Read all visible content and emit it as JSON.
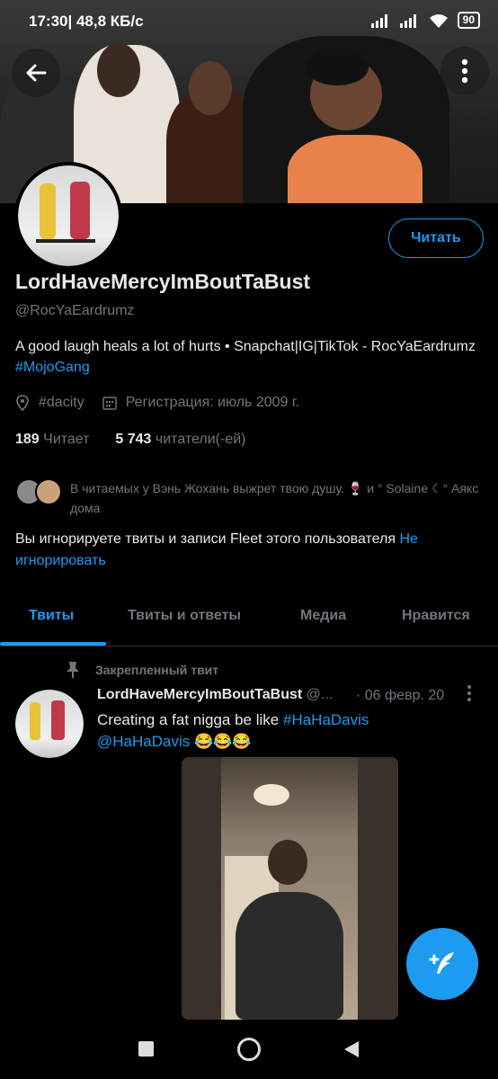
{
  "status_bar": {
    "time": "17:30",
    "speed": "| 48,8 КБ/с",
    "battery": "90"
  },
  "profile": {
    "display_name": "LordHaveMercyImBoutTaBust",
    "handle": "@RocYaEardrumz",
    "bio_text": "A good laugh heals a lot of hurts • Snapchat|IG|TikTok - RocYaEardrumz",
    "bio_hashtag": "#MojoGang",
    "location": "#dacity",
    "joined": "Регистрация: июль 2009 г.",
    "following_count": "189",
    "following_label": "Читает",
    "followers_count": "5 743",
    "followers_label": "читатели(-ей)",
    "known_followers_text": "В читаемых у Вэнь Жохань выжрет твою душу. 🍷 и ° Solaine ☾° Аякс дома",
    "ignore_text": "Вы игнорируете твиты и записи Fleet этого пользователя",
    "ignore_link": "Не игнорировать",
    "follow_button": "Читать"
  },
  "tabs": [
    {
      "label": "Твиты",
      "active": true
    },
    {
      "label": "Твиты и ответы",
      "active": false
    },
    {
      "label": "Медиа",
      "active": false
    },
    {
      "label": "Нравится",
      "active": false
    }
  ],
  "tweet": {
    "pinned_label": "Закрепленный твит",
    "author": "LordHaveMercyImBoutTaBust",
    "handle_truncated": "@...",
    "date": "· 06 февр. 20",
    "text": "Creating a fat nigga be like",
    "hashtag": "#HaHaDavis",
    "mention": "@HaHaDavis",
    "emoji": "😂😂😂"
  },
  "colors": {
    "accent": "#1d9bf0",
    "background": "#000000",
    "muted": "#71767b"
  }
}
